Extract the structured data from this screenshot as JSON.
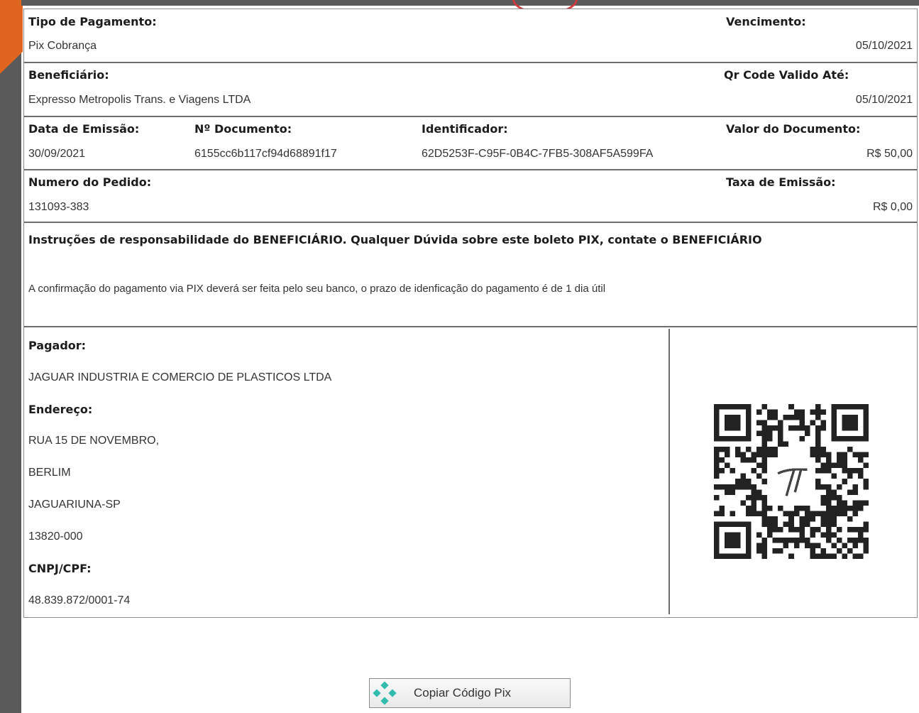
{
  "tipo_pagamento": {
    "label": "Tipo de Pagamento:",
    "value": "Pix Cobrança"
  },
  "vencimento": {
    "label": "Vencimento:",
    "value": "05/10/2021"
  },
  "beneficiario": {
    "label": "Beneficiário:",
    "value": "Expresso Metropolis Trans. e Viagens LTDA"
  },
  "qr_valido": {
    "label": "Qr Code Valido Até:",
    "value": "05/10/2021"
  },
  "data_emissao": {
    "label": "Data de Emissão:",
    "value": "30/09/2021"
  },
  "documento": {
    "label": "Nº Documento:",
    "value": "6155cc6b117cf94d68891f17"
  },
  "identificador": {
    "label": "Identificador:",
    "value": "62D5253F-C95F-0B4C-7FB5-308AF5A599FA"
  },
  "valor_documento": {
    "label": "Valor do Documento:",
    "value": "R$ 50,00"
  },
  "numero_pedido": {
    "label": "Numero do Pedido:",
    "value": "131093-383"
  },
  "taxa_emissao": {
    "label": "Taxa de Emissão:",
    "value": "R$ 0,00"
  },
  "instrucoes": {
    "title": "Instruções de responsabilidade do BENEFICIÁRIO. Qualquer Dúvida sobre este boleto PIX, contate o BENEFICIÁRIO",
    "text": "A confirmação do pagamento via PIX deverá ser feita pelo seu banco, o prazo de idenficação do pagamento é de 1 dia útil"
  },
  "pagador": {
    "label": "Pagador:",
    "name": "JAGUAR INDUSTRIA E COMERCIO DE PLASTICOS LTDA",
    "endereco_label": "Endereço:",
    "endereco_lines": [
      "RUA 15 DE NOVEMBRO,",
      "BERLIM",
      "JAGUARIUNA-SP",
      "13820-000"
    ],
    "cnpj_label": "CNPJ/CPF:",
    "cnpj": "48.839.872/0001-74"
  },
  "copy_button": {
    "label": "Copiar Código Pix",
    "icon": "pix-icon"
  },
  "colors": {
    "accent_orange": "#e0661f",
    "pix_teal": "#32bcad",
    "border": "#6d6d6d"
  }
}
